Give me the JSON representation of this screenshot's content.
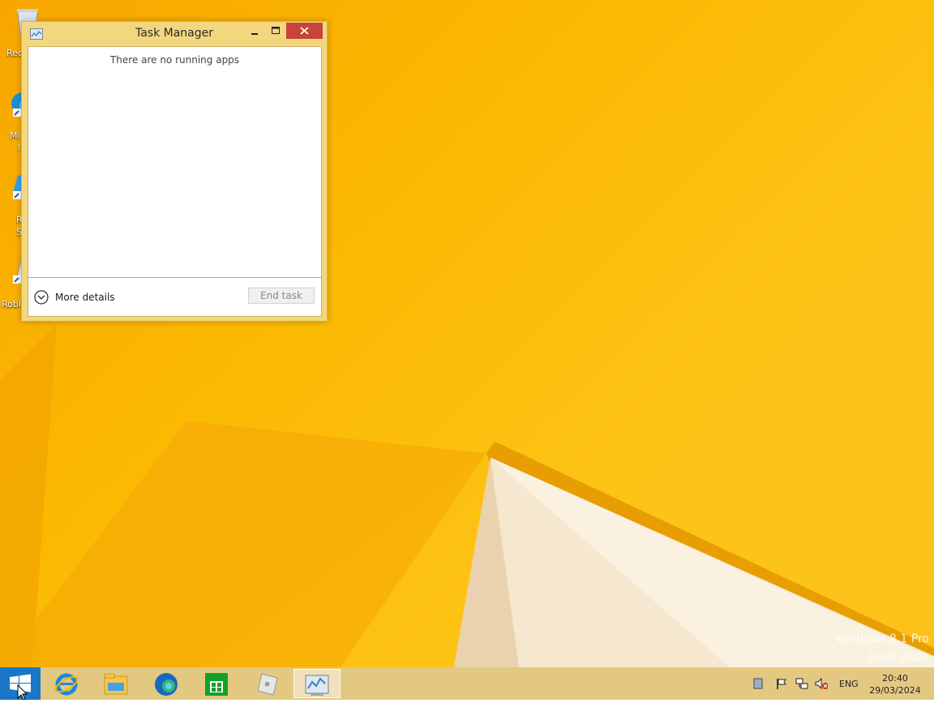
{
  "desktop": {
    "icons": [
      {
        "label": "Rec",
        "icon": "recycle-bin-icon"
      },
      {
        "label": "Mi",
        "label2": "l",
        "icon": "edge-shortcut-icon"
      },
      {
        "label": "R",
        "label2": "S",
        "icon": "roblox-studio-shortcut-icon"
      },
      {
        "label": "Robl",
        "icon": "roblox-shortcut-icon"
      }
    ],
    "watermark": {
      "line1": "Windows 8.1 Pro",
      "line2": "Build 9600"
    },
    "colors": {
      "wallpaper": "#fbb800",
      "accent": "#f2d77f"
    }
  },
  "window": {
    "title": "Task Manager",
    "no_apps_text": "There are no running apps",
    "more_details_label": "More details",
    "end_task_label": "End task",
    "end_task_enabled": false
  },
  "taskbar": {
    "apps": [
      {
        "name": "internet-explorer",
        "icon": "internet-explorer-icon"
      },
      {
        "name": "file-explorer",
        "icon": "file-explorer-icon"
      },
      {
        "name": "microsoft-edge",
        "icon": "edge-icon"
      },
      {
        "name": "store",
        "icon": "store-icon"
      },
      {
        "name": "roblox",
        "icon": "roblox-icon"
      },
      {
        "name": "task-manager",
        "icon": "task-manager-icon",
        "active": true
      }
    ],
    "tray": {
      "language": "ENG",
      "time": "20:40",
      "date": "29/03/2024"
    }
  }
}
